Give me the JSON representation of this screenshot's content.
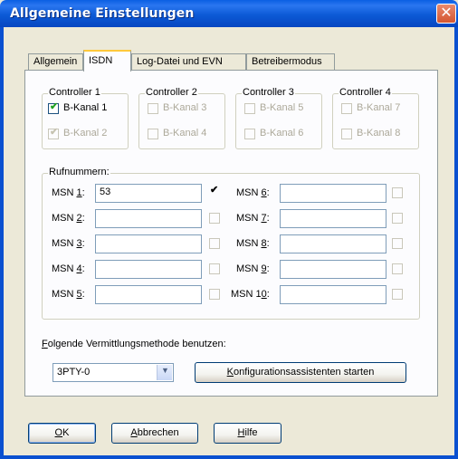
{
  "window": {
    "title": "Allgemeine Einstellungen",
    "close_glyph": "✕"
  },
  "tabs": [
    {
      "label": "Allgemein"
    },
    {
      "label": "ISDN",
      "active": true
    },
    {
      "label": "Log-Datei und EVN"
    },
    {
      "label": "Betreibermodus"
    }
  ],
  "controllers": [
    {
      "title": "Controller 1",
      "channels": [
        {
          "label": "B-Kanal 1",
          "checked": true,
          "enabled": true
        },
        {
          "label": "B-Kanal 2",
          "checked": true,
          "enabled": false
        }
      ]
    },
    {
      "title": "Controller 2",
      "channels": [
        {
          "label": "B-Kanal 3",
          "checked": false,
          "enabled": false
        },
        {
          "label": "B-Kanal 4",
          "checked": false,
          "enabled": false
        }
      ]
    },
    {
      "title": "Controller 3",
      "channels": [
        {
          "label": "B-Kanal 5",
          "checked": false,
          "enabled": false
        },
        {
          "label": "B-Kanal 6",
          "checked": false,
          "enabled": false
        }
      ]
    },
    {
      "title": "Controller 4",
      "channels": [
        {
          "label": "B-Kanal 7",
          "checked": false,
          "enabled": false
        },
        {
          "label": "B-Kanal 8",
          "checked": false,
          "enabled": false
        }
      ]
    }
  ],
  "rufnummern": {
    "title": "Rufnummern:",
    "msn": [
      {
        "prefix": "MSN ",
        "num": "1",
        "value": "53",
        "checked": true
      },
      {
        "prefix": "MSN ",
        "num": "2",
        "value": "",
        "checked": false
      },
      {
        "prefix": "MSN ",
        "num": "3",
        "value": "",
        "checked": false
      },
      {
        "prefix": "MSN ",
        "num": "4",
        "value": "",
        "checked": false
      },
      {
        "prefix": "MSN ",
        "num": "5",
        "value": "",
        "checked": false
      },
      {
        "prefix": "MSN ",
        "num": "6",
        "value": "",
        "checked": false
      },
      {
        "prefix": "MSN ",
        "num": "7",
        "value": "",
        "checked": false
      },
      {
        "prefix": "MSN ",
        "num": "8",
        "value": "",
        "checked": false
      },
      {
        "prefix": "MSN ",
        "num": "9",
        "value": "",
        "checked": false
      },
      {
        "prefix": "MSN 1",
        "num": "0",
        "value": "",
        "checked": false
      }
    ]
  },
  "method": {
    "label_first": "F",
    "label_rest": "olgende Vermittlungsmethode benutzen:",
    "selected": "3PTY-0",
    "wizard_first": "K",
    "wizard_rest": "onfigurationsassistenten starten"
  },
  "check_glyph": "✔",
  "footer": {
    "ok_first": "O",
    "ok_rest": "K",
    "cancel_first": "A",
    "cancel_rest": "bbrechen",
    "help_first": "H",
    "help_rest": "ilfe"
  }
}
